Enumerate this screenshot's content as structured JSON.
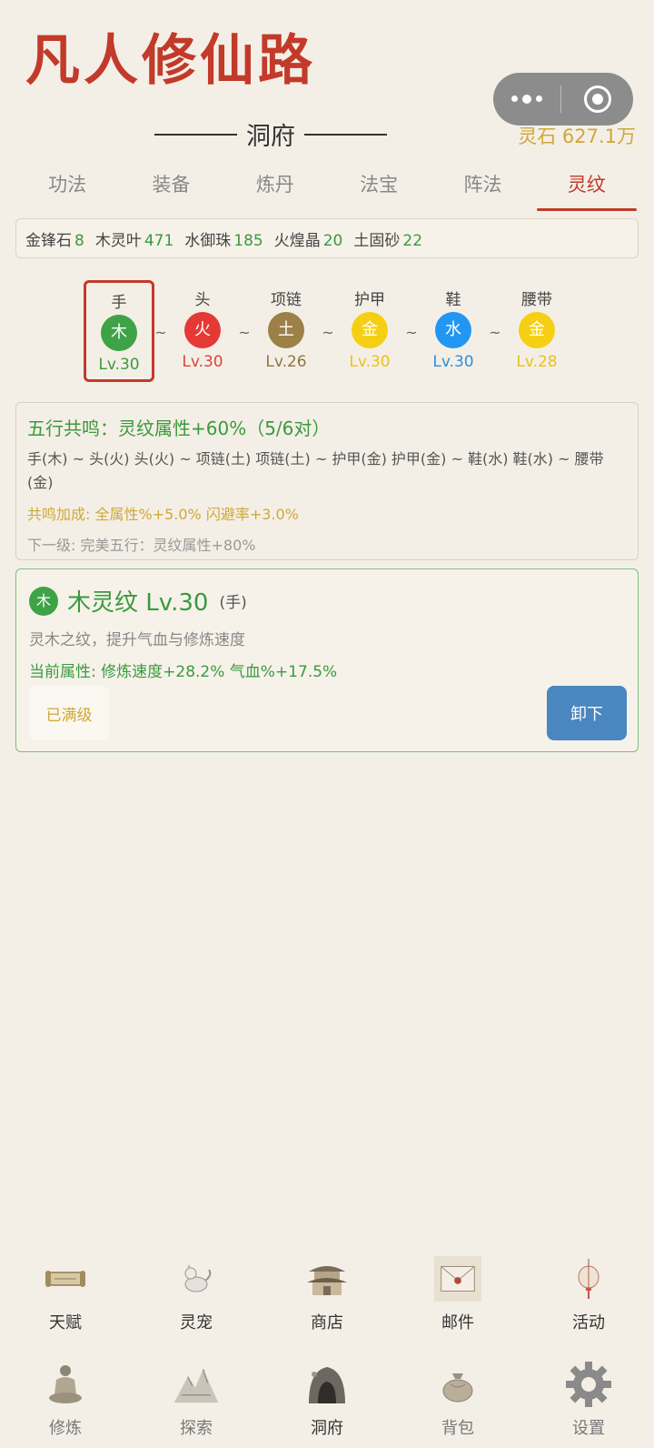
{
  "app": {
    "title": "凡人修仙路"
  },
  "capsule": {
    "more_icon": "more-dots-icon",
    "close_icon": "target-icon"
  },
  "header": {
    "section": "洞府",
    "spirit_stone": "灵石 627.1万"
  },
  "tabs": [
    {
      "label": "功法",
      "active": false
    },
    {
      "label": "装备",
      "active": false
    },
    {
      "label": "炼丹",
      "active": false
    },
    {
      "label": "法宝",
      "active": false
    },
    {
      "label": "阵法",
      "active": false
    },
    {
      "label": "灵纹",
      "active": true
    }
  ],
  "materials": [
    {
      "name": "金锋石",
      "count": "8"
    },
    {
      "name": "木灵叶",
      "count": "471"
    },
    {
      "name": "水御珠",
      "count": "185"
    },
    {
      "name": "火煌晶",
      "count": "20"
    },
    {
      "name": "土固砂",
      "count": "22"
    }
  ],
  "slots": [
    {
      "label": "手",
      "element": "木",
      "level": "Lv.30",
      "color": "#3ea346",
      "lvcolor": "#3a9a3e",
      "selected": true
    },
    {
      "label": "头",
      "element": "火",
      "level": "Lv.30",
      "color": "#e53935",
      "lvcolor": "#d9453a",
      "selected": false
    },
    {
      "label": "项链",
      "element": "土",
      "level": "Lv.26",
      "color": "#9c8047",
      "lvcolor": "#8f7540",
      "selected": false
    },
    {
      "label": "护甲",
      "element": "金",
      "level": "Lv.30",
      "color": "#f5cf14",
      "lvcolor": "#e8c21a",
      "selected": false
    },
    {
      "label": "鞋",
      "element": "水",
      "level": "Lv.30",
      "color": "#2196f3",
      "lvcolor": "#2d8fe0",
      "selected": false
    },
    {
      "label": "腰带",
      "element": "金",
      "level": "Lv.28",
      "color": "#f5cf14",
      "lvcolor": "#e8c21a",
      "selected": false
    }
  ],
  "slot_separator": "~",
  "resonance": {
    "title": "五行共鸣：灵纹属性+60%（5/6对）",
    "pairs": "手(木) ~ 头(火)  头(火) ~ 项链(土)  项链(土) ~ 护甲(金)  护甲(金) ~ 鞋(水)  鞋(水) ~ 腰带(金)",
    "bonus": "共鸣加成: 全属性%+5.0%  闪避率+3.0%",
    "next": "下一级: 完美五行：灵纹属性+80%"
  },
  "detail": {
    "element": "木",
    "name": "木灵纹 Lv.30",
    "slot": "(手)",
    "desc": "灵木之纹，提升气血与修炼速度",
    "attr": "当前属性: 修炼速度+28.2%  气血%+17.5%",
    "max_label": "已满级",
    "unload_label": "卸下"
  },
  "nav_top": [
    {
      "label": "天赋",
      "icon": "scroll-icon"
    },
    {
      "label": "灵宠",
      "icon": "pet-icon"
    },
    {
      "label": "商店",
      "icon": "pavilion-icon"
    },
    {
      "label": "邮件",
      "icon": "envelope-icon"
    },
    {
      "label": "活动",
      "icon": "lantern-icon"
    }
  ],
  "nav_bottom": [
    {
      "label": "修炼",
      "icon": "meditation-icon"
    },
    {
      "label": "探索",
      "icon": "mountain-icon"
    },
    {
      "label": "洞府",
      "icon": "cave-icon",
      "active": true
    },
    {
      "label": "背包",
      "icon": "bag-icon"
    },
    {
      "label": "设置",
      "icon": "gear-icon"
    }
  ]
}
